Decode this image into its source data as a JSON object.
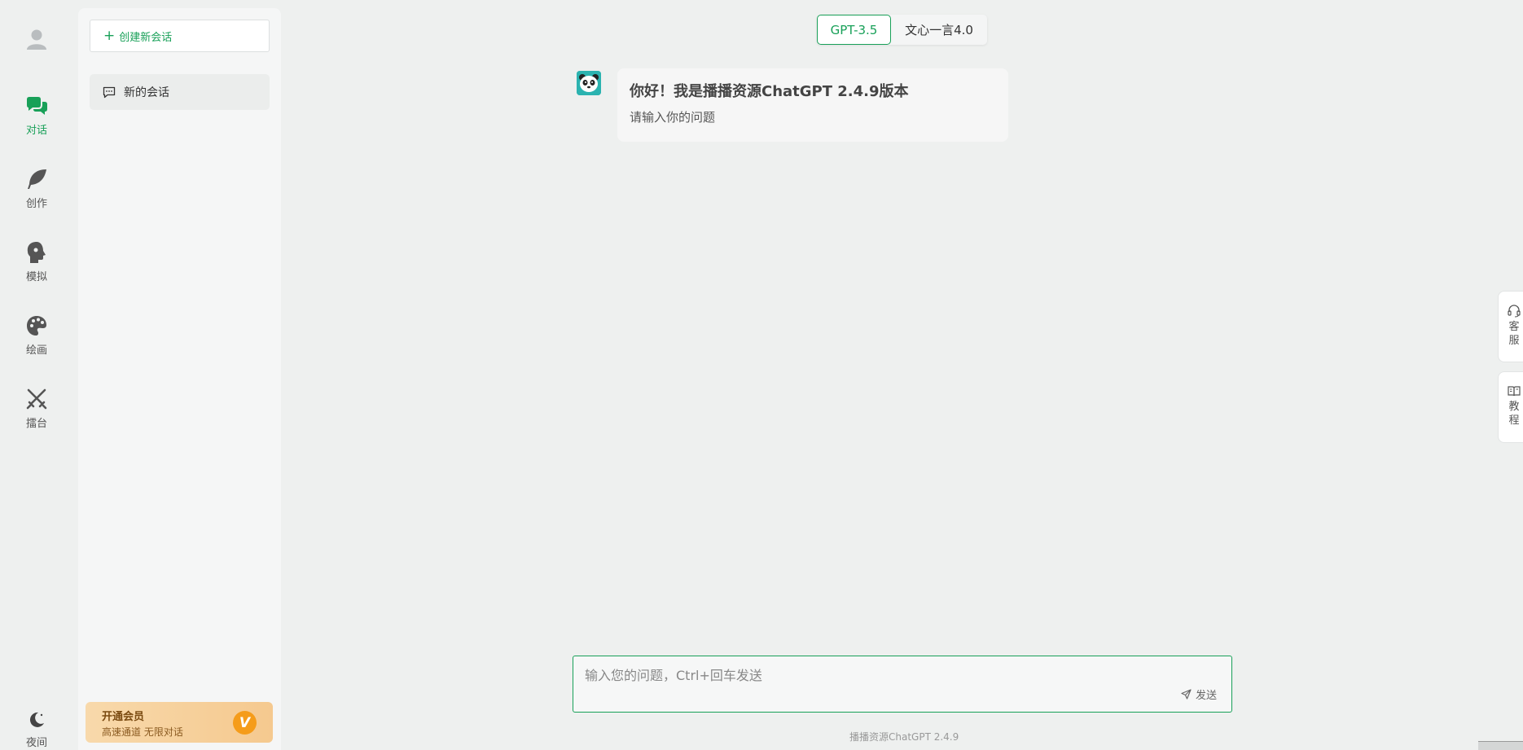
{
  "rail": {
    "items": [
      {
        "label": "对话",
        "icon": "chat-bubbles-icon",
        "active": true
      },
      {
        "label": "创作",
        "icon": "feather-icon"
      },
      {
        "label": "模拟",
        "icon": "head-profile-icon"
      },
      {
        "label": "绘画",
        "icon": "palette-icon"
      },
      {
        "label": "擂台",
        "icon": "crossed-swords-icon"
      }
    ],
    "night_label": "夜间"
  },
  "panel": {
    "new_chat_label": "创建新会话",
    "sessions": [
      {
        "title": "新的会话"
      }
    ],
    "vip": {
      "title": "开通会员",
      "subtitle": "高速通道 无限对话",
      "badge": "V"
    }
  },
  "models": {
    "options": [
      "GPT-3.5",
      "文心一言4.0"
    ],
    "selected": "GPT-3.5"
  },
  "message": {
    "title": "你好！我是播播资源ChatGPT 2.4.9版本",
    "subtitle": "请输入你的问题"
  },
  "input": {
    "placeholder": "输入您的问题，Ctrl+回车发送",
    "send_label": "发送"
  },
  "footer": "播播资源ChatGPT 2.4.9",
  "float_tabs": [
    {
      "label": "客服",
      "chars": [
        "客",
        "服"
      ],
      "icon": "headset-icon"
    },
    {
      "label": "教程",
      "chars": [
        "教",
        "程"
      ],
      "icon": "book-icon"
    }
  ],
  "colors": {
    "accent": "#18a058",
    "background": "#eef0ef",
    "vip": "#f5c98f"
  }
}
